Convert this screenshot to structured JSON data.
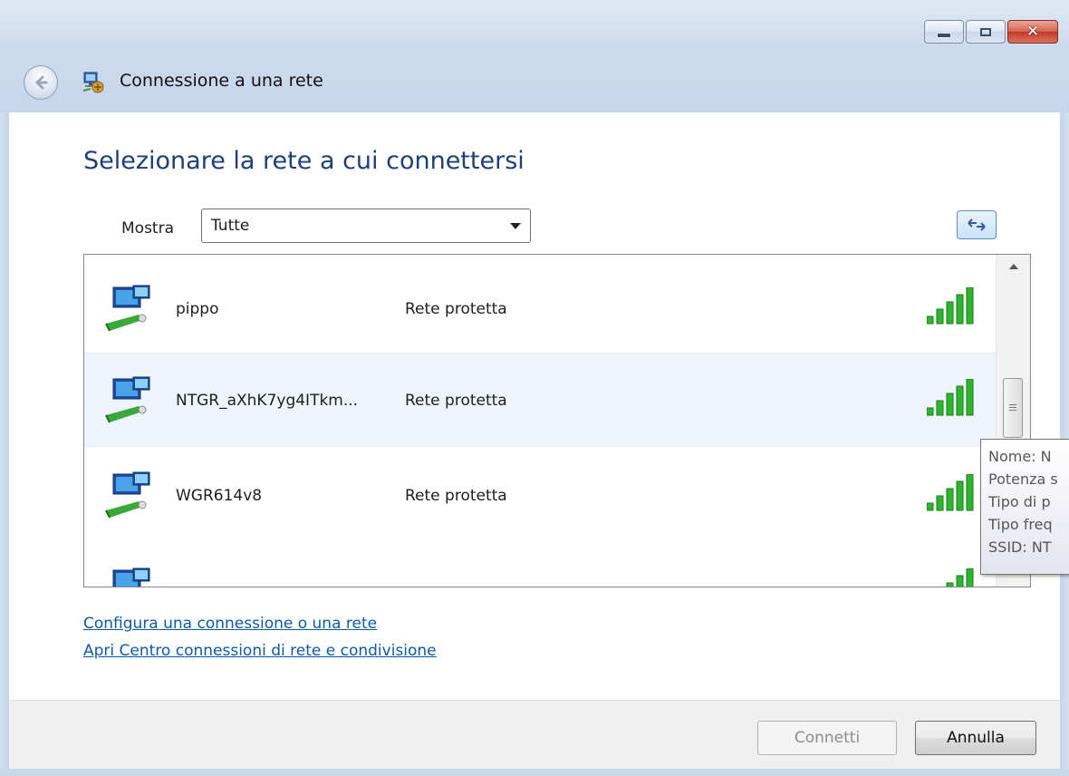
{
  "window": {
    "title": "Connessione a una rete"
  },
  "main": {
    "heading": "Selezionare la rete a cui connettersi",
    "show_label": "Mostra",
    "show_value": "Tutte"
  },
  "networks": [
    {
      "name": "pippo",
      "security": "Rete protetta",
      "signal_bars": 5
    },
    {
      "name": "NTGR_aXhK7yg4ITkm...",
      "security": "Rete protetta",
      "signal_bars": 5
    },
    {
      "name": "WGR614v8",
      "security": "Rete protetta",
      "signal_bars": 5
    }
  ],
  "tooltip": {
    "lines": [
      "Nome: N",
      "Potenza s",
      "Tipo di p",
      "Tipo freq",
      "SSID: NT"
    ]
  },
  "links": {
    "setup": "Configura una connessione o una rete",
    "center": "Apri Centro connessioni di rete e condivisione"
  },
  "buttons": {
    "connect": "Connetti",
    "cancel": "Annulla"
  },
  "colors": {
    "heading": "#1e3f7c",
    "link": "#0e5aa8",
    "signal": "#2db52d",
    "selection": "#eef5fc"
  }
}
